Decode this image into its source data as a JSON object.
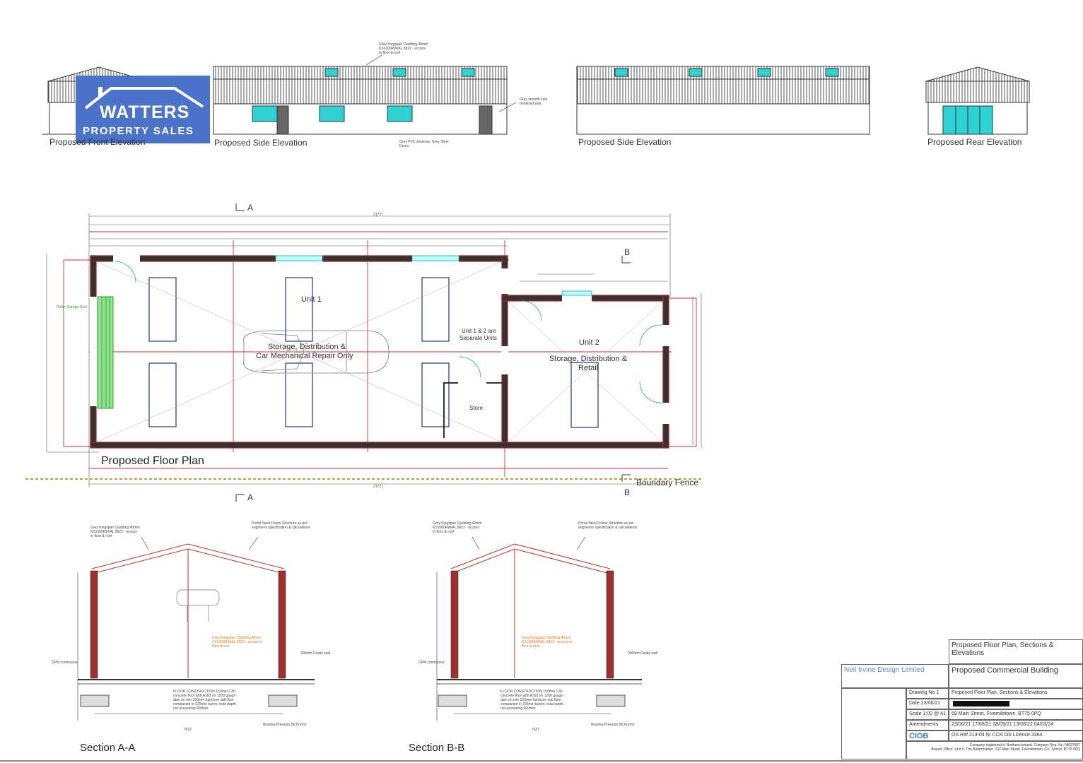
{
  "logo": {
    "name": "WATTERS",
    "subtitle": "PROPERTY SALES"
  },
  "elevations": {
    "front": "Proposed Front Elevation",
    "side1": "Proposed Side Elevation",
    "side2": "Proposed Side Elevation",
    "rear": "Proposed Rear Elevation",
    "cladding_note": "Grey Kingspan Cladding 40mm KS1000RW/AL 9922 - access to floor & roof",
    "render_note": "Grey smooth cast rendered wall",
    "windows_note": "Grey PVC windows, Grey Steel Doors"
  },
  "plan": {
    "title": "Proposed Floor Plan",
    "unit1": "Unit 1",
    "unit1_use_1": "Storage, Distribution &",
    "unit1_use_2": "Car Mechanical Repair Only",
    "separate_1": "Unit 1 & 2 are",
    "separate_2": "Separate Units",
    "unit2": "Unit 2",
    "unit2_use_1": "Storage, Distribution &",
    "unit2_use_2": "Retail",
    "store": "Store",
    "boundary": "Boundary Fence",
    "section_a": "A",
    "section_b": "B",
    "overall_dim": "21727",
    "garage_door": "Roller Garage Door"
  },
  "sections": {
    "aa": "Section A-A",
    "bb": "Section B-B",
    "cladding": "Grey Kingspan Cladding 40mm KS1000RW/AL 9922 - access to floor & roof",
    "frame": "Portal Steel Frame Structure as per engineers specification & calculations",
    "floor": "FLOOR CONSTRUCTION 150mm C30 concrete floor with A393 on 1200 gauge dpm on min 150mm hardcore sub floor compacted in 225mm layers, total depth not exceeding 600mm",
    "cavity": "300mm Cavity wall",
    "dpm": "DPM continuous",
    "bearing": "Bearing Pressure 80 Kn/m2",
    "span": "7637"
  },
  "titleblock": {
    "drawing_title": "Proposed Floor Plan, Sections & Elevations",
    "project": "Proposed Commercial Building",
    "company": "Neil Irvine Design Limited",
    "row_drawing_label": "Drawing No 1",
    "row_drawing_value": "Proposed Floor Plan, Sections & Elevations",
    "row_date_label": "Date 23/06/21",
    "row_date_value": "",
    "row_scale_label": "Scale 1:00 @ A1",
    "row_scale_value": "59 Main Street, Fivemiletown, BT75 0PQ",
    "row_amend_label": "Amendments",
    "row_amend_value": "23/06/21 17/08/21 08/09/21 13/06/22 04/03/24",
    "ciob": "CIOB",
    "os_ref": "OS Ref 213-04 NI CCR OS Licence 3364",
    "registered": "Company registered in Northern Ireland. Company Reg. No. NI637687",
    "branch": "Branch Office: Unit 5, The Buttermarket, 132 Main Street, Fivemiletown, Co. Tyrone, BT75 0PQ"
  }
}
